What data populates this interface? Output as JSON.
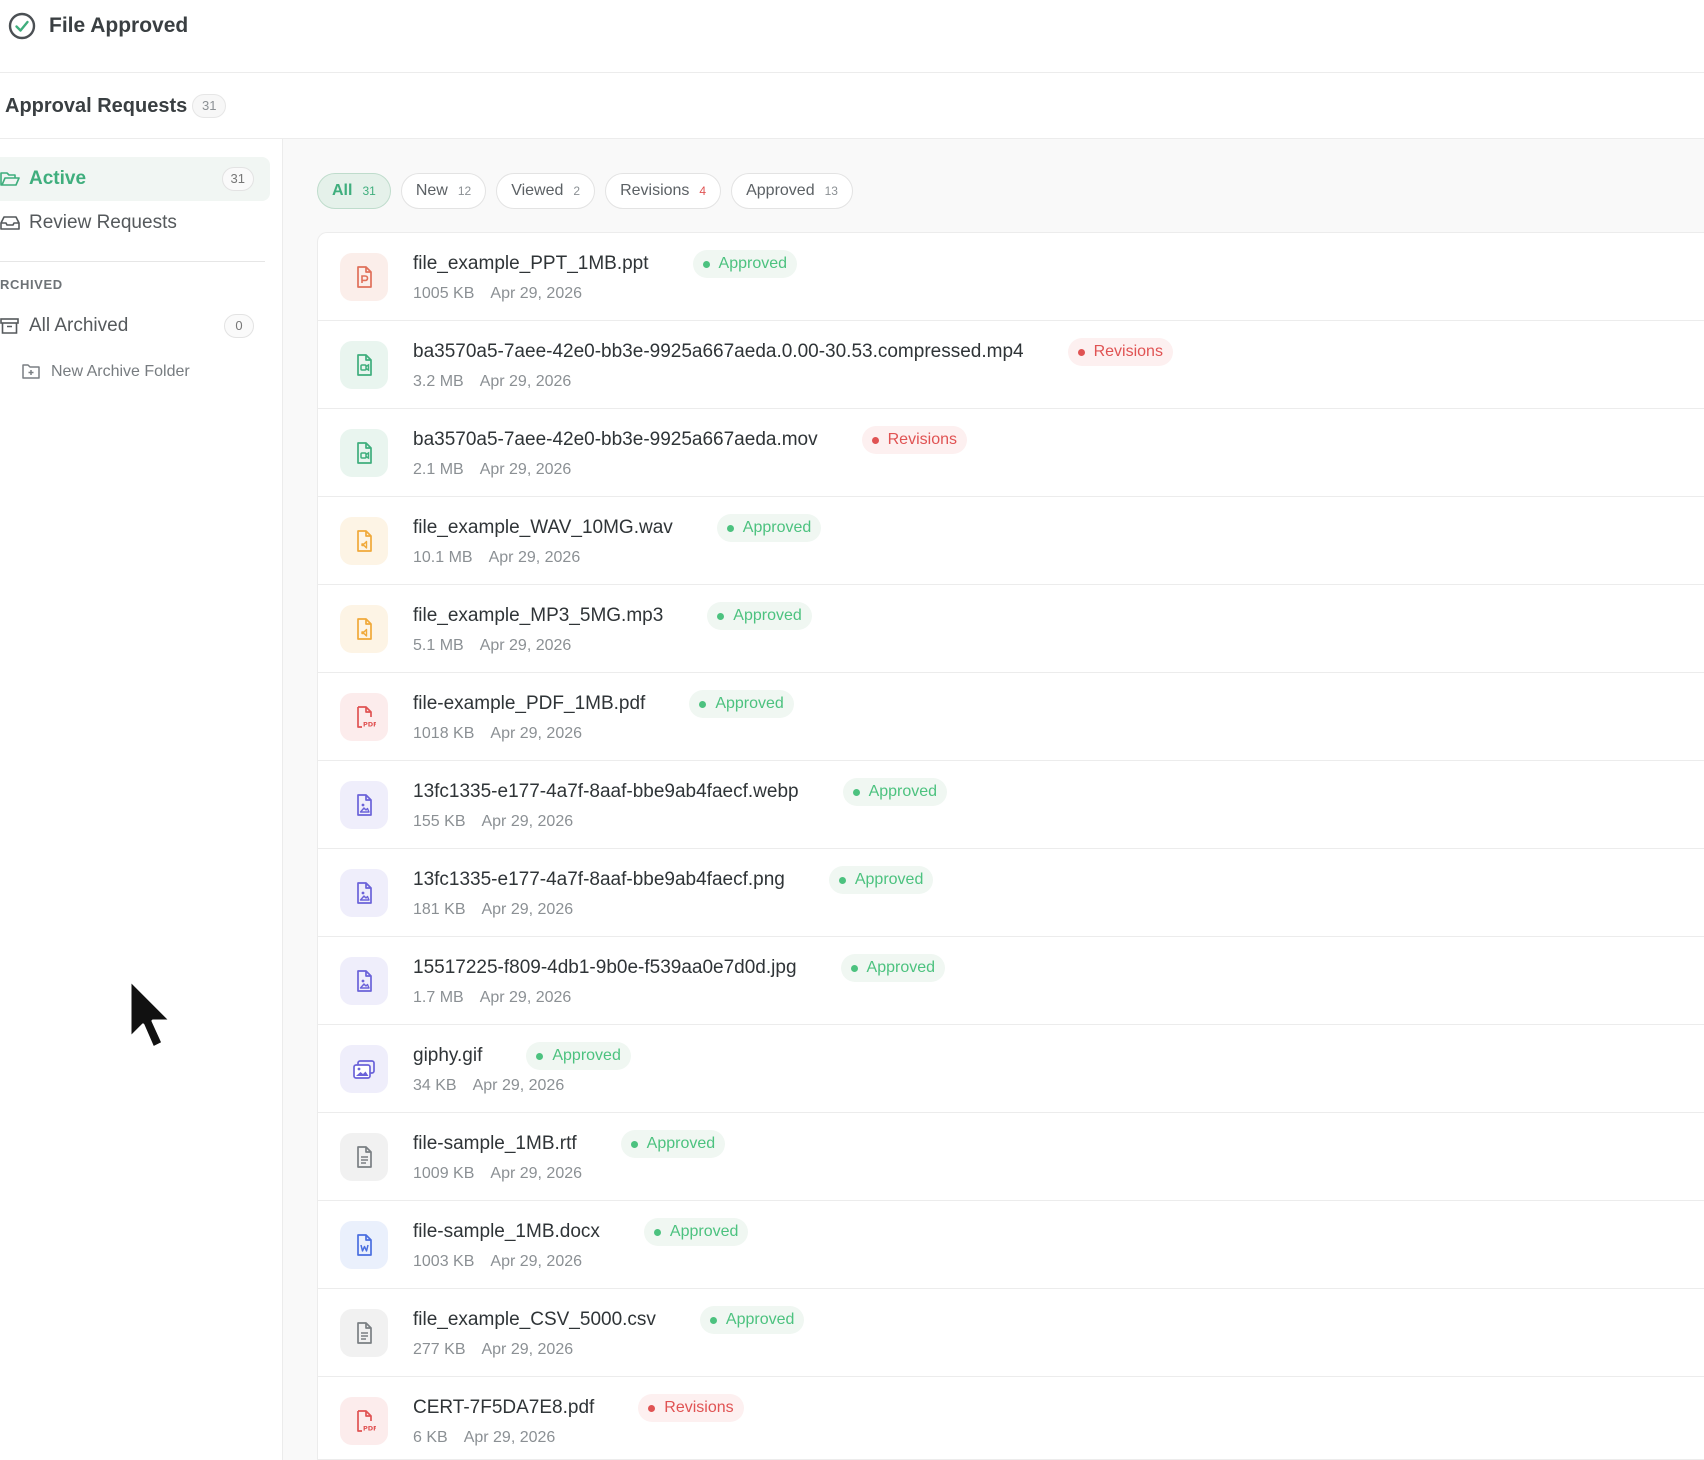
{
  "header": {
    "title": "File Approved"
  },
  "subheader": {
    "title": "Approval Requests",
    "count": "31"
  },
  "sidebar": {
    "items": [
      {
        "label": "Active",
        "count": "31",
        "icon": "folder-open-icon"
      },
      {
        "label": "Review Requests",
        "icon": "inbox-icon"
      }
    ],
    "section_label": "RCHIVED",
    "archived": {
      "label": "All Archived",
      "count": "0",
      "icon": "archive-icon"
    },
    "new_folder": {
      "label": "New Archive Folder",
      "icon": "folder-plus-icon"
    }
  },
  "tabs": [
    {
      "label": "All",
      "count": "31"
    },
    {
      "label": "New",
      "count": "12"
    },
    {
      "label": "Viewed",
      "count": "2"
    },
    {
      "label": "Revisions",
      "count": "4"
    },
    {
      "label": "Approved",
      "count": "13"
    }
  ],
  "files": [
    {
      "name": "file_example_PPT_1MB.ppt",
      "status": "Approved",
      "size": "1005 KB",
      "date": "Apr 29, 2026",
      "type": "ppt",
      "icon": "presentation-file-icon"
    },
    {
      "name": "ba3570a5-7aee-42e0-bb3e-9925a667aeda.0.00-30.53.compressed.mp4",
      "status": "Revisions",
      "size": "3.2 MB",
      "date": "Apr 29, 2026",
      "type": "video",
      "icon": "video-file-icon"
    },
    {
      "name": "ba3570a5-7aee-42e0-bb3e-9925a667aeda.mov",
      "status": "Revisions",
      "size": "2.1 MB",
      "date": "Apr 29, 2026",
      "type": "video",
      "icon": "video-file-icon"
    },
    {
      "name": "file_example_WAV_10MG.wav",
      "status": "Approved",
      "size": "10.1 MB",
      "date": "Apr 29, 2026",
      "type": "audio",
      "icon": "audio-file-icon"
    },
    {
      "name": "file_example_MP3_5MG.mp3",
      "status": "Approved",
      "size": "5.1 MB",
      "date": "Apr 29, 2026",
      "type": "audio",
      "icon": "audio-file-icon"
    },
    {
      "name": "file-example_PDF_1MB.pdf",
      "status": "Approved",
      "size": "1018 KB",
      "date": "Apr 29, 2026",
      "type": "pdf",
      "icon": "pdf-file-icon"
    },
    {
      "name": "13fc1335-e177-4a7f-8aaf-bbe9ab4faecf.webp",
      "status": "Approved",
      "size": "155 KB",
      "date": "Apr 29, 2026",
      "type": "image",
      "icon": "image-file-icon"
    },
    {
      "name": "13fc1335-e177-4a7f-8aaf-bbe9ab4faecf.png",
      "status": "Approved",
      "size": "181 KB",
      "date": "Apr 29, 2026",
      "type": "image",
      "icon": "image-file-icon"
    },
    {
      "name": "15517225-f809-4db1-9b0e-f539aa0e7d0d.jpg",
      "status": "Approved",
      "size": "1.7 MB",
      "date": "Apr 29, 2026",
      "type": "image",
      "icon": "image-file-icon"
    },
    {
      "name": "giphy.gif",
      "status": "Approved",
      "size": "34 KB",
      "date": "Apr 29, 2026",
      "type": "gif",
      "icon": "images-icon"
    },
    {
      "name": "file-sample_1MB.rtf",
      "status": "Approved",
      "size": "1009 KB",
      "date": "Apr 29, 2026",
      "type": "text",
      "icon": "text-file-icon"
    },
    {
      "name": "file-sample_1MB.docx",
      "status": "Approved",
      "size": "1003 KB",
      "date": "Apr 29, 2026",
      "type": "word",
      "icon": "word-file-icon"
    },
    {
      "name": "file_example_CSV_5000.csv",
      "status": "Approved",
      "size": "277 KB",
      "date": "Apr 29, 2026",
      "type": "text",
      "icon": "text-file-icon"
    },
    {
      "name": "CERT-7F5DA7E8.pdf",
      "status": "Revisions",
      "size": "6 KB",
      "date": "Apr 29, 2026",
      "type": "pdf",
      "icon": "pdf-file-icon"
    }
  ],
  "colors": {
    "accent": "#3fae7d",
    "approved": "#4cc27f",
    "revisions": "#e05353",
    "ppt": "#e0705a",
    "video": "#3fae7d",
    "audio": "#f0a93a",
    "pdf": "#e05353",
    "image": "#6b63d9",
    "word": "#4a6fe0",
    "text": "#7a7f83"
  }
}
